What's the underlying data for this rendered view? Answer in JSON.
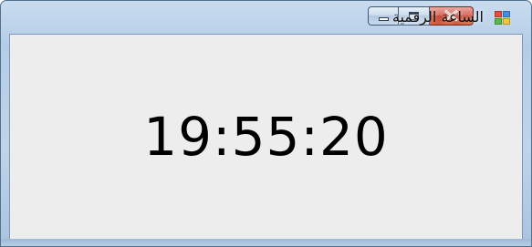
{
  "window": {
    "title": "الساعة الرقمية",
    "app_icon": "app-window-icon",
    "buttons": {
      "minimize_icon": "minimize-icon",
      "maximize_icon": "maximize-icon",
      "close_icon": "close-icon"
    },
    "colors": {
      "close_button": "#c23d2d",
      "client_background": "#ededed",
      "frame": "#b4cde6"
    }
  },
  "clock": {
    "time": "19:55:20"
  }
}
